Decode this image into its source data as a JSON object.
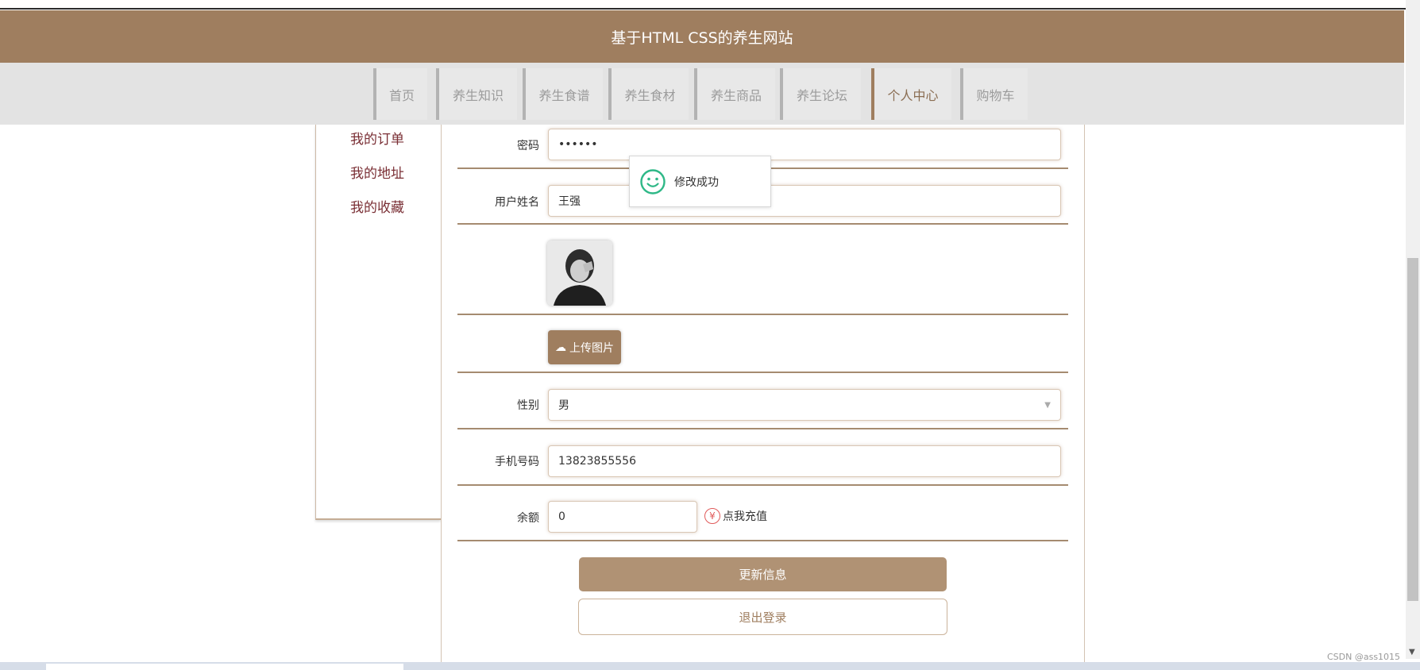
{
  "header": {
    "title": "基于HTML CSS的养生网站"
  },
  "nav": {
    "items": [
      "首页",
      "养生知识",
      "养生食谱",
      "养生食材",
      "养生商品",
      "养生论坛",
      "个人中心",
      "购物车"
    ],
    "active": "个人中心"
  },
  "sidebar": {
    "items": [
      "我的订单",
      "我的地址",
      "我的收藏"
    ]
  },
  "form": {
    "password_label": "密码",
    "password_value": "••••••",
    "name_label": "用户姓名",
    "name_value": "王强",
    "upload_label": "上传图片",
    "gender_label": "性别",
    "gender_value": "男",
    "phone_label": "手机号码",
    "phone_value": "13823855556",
    "balance_label": "余额",
    "balance_value": "0",
    "recharge_icon": "¥",
    "recharge_label": "点我充值"
  },
  "toast": {
    "message": "修改成功",
    "icon": "smile-icon"
  },
  "buttons": {
    "update": "更新信息",
    "logout": "退出登录"
  },
  "watermark": "CSDN @ass1015",
  "colors": {
    "brand": "#9f7e5f",
    "sidebar_link": "#7a2f35",
    "toast_icon": "#2eb887"
  }
}
